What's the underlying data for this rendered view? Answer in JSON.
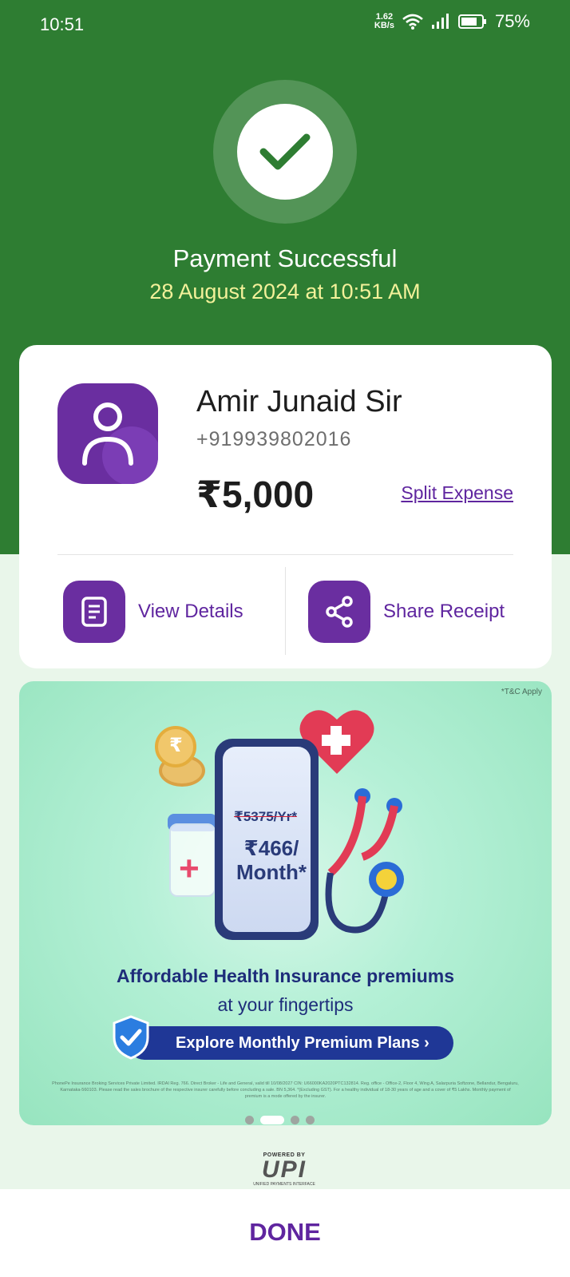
{
  "status_bar": {
    "time": "10:51",
    "net_speed_value": "1.62",
    "net_speed_unit": "KB/s",
    "battery": "75%"
  },
  "header": {
    "title": "Payment Successful",
    "datetime": "28 August 2024 at 10:51 AM"
  },
  "payee": {
    "name": "Amir Junaid Sir",
    "phone": "+919939802016",
    "amount": "₹5,000",
    "split_label": "Split Expense"
  },
  "actions": {
    "view_details": "View Details",
    "share_receipt": "Share Receipt"
  },
  "banner": {
    "tnc": "*T&C Apply",
    "old_price": "₹5375/Yr*",
    "new_price": "₹466/ Month*",
    "headline": "Affordable Health Insurance premiums",
    "subheadline": "at your fingertips",
    "cta": "Explore Monthly Premium Plans ›",
    "fine_print": "PhonePe Insurance Broking Services Private Limited. IRDAI Reg. 766. Direct Broker - Life and General, valid till 10/08/2027 CIN: U66000KA2020PTC132814. Reg. office - Office-2, Floor 4, Wing A, Salarpuria Softzone, Bellandur, Bengaluru, Karnataka-560103. Please read the sales brochure of the respective insurer carefully before concluding a sale. BN 5,364. *(Excluding GST). For a healthy individual of 18-30 years of age and a cover of ₹5 Lakhs. Monthly payment of premium is a mode offered by the insurer.",
    "active_slide": 2,
    "total_slides": 4
  },
  "upi": {
    "powered_by": "POWERED BY",
    "logo": "UPI",
    "tagline": "UNIFIED PAYMENTS INTERFACE"
  },
  "footer": {
    "done_label": "DONE"
  },
  "colors": {
    "hero_green": "#2e7d32",
    "brand_purple": "#5f259f",
    "date_yellow": "#f3f19a"
  }
}
